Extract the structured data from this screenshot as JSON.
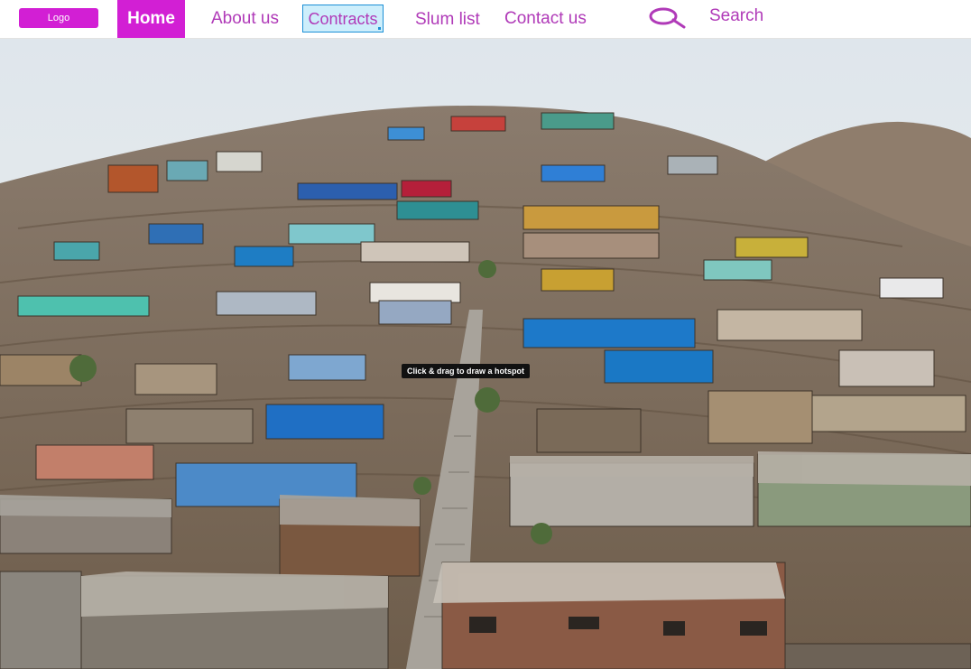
{
  "nav": {
    "logo": "Logo",
    "home": "Home",
    "about": "About us",
    "contracts": "Contracts",
    "slum_list": "Slum list",
    "contact": "Contact  us",
    "search_label": "Search",
    "search_icon": "search-icon",
    "accent_color": "#d21fd4",
    "link_color": "#b03ab8"
  },
  "hero": {
    "image_subject": "hillside informal settlement photo",
    "hotspot_hint": "Click & drag to draw a hotspot"
  }
}
